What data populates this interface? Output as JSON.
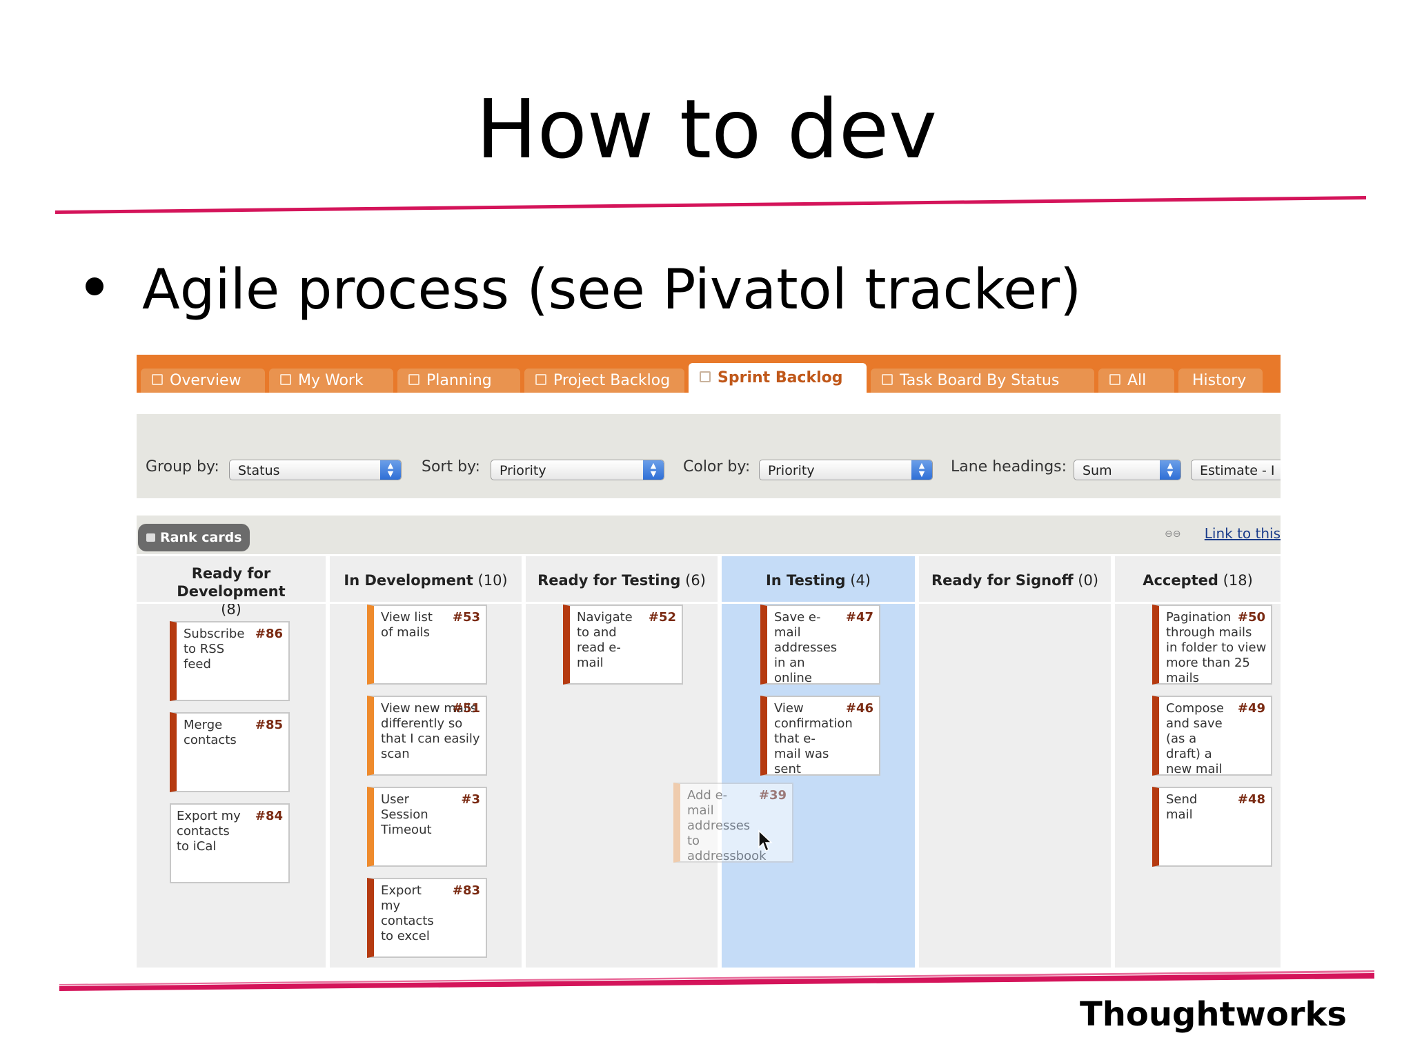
{
  "slide": {
    "title": "How to dev",
    "bullet": "Agile process (see Pivatol tracker)",
    "footer_brand": "Thoughtworks"
  },
  "colors": {
    "accent_rule": "#d4145a",
    "tab_bar": "#e8792a",
    "active_lane": "#c5dcf7",
    "card_red": "#b53a10",
    "card_orange": "#ee8a2c"
  },
  "app": {
    "tabs": [
      {
        "label": "Overview",
        "icon": "page-icon"
      },
      {
        "label": "My Work",
        "icon": "list-icon"
      },
      {
        "label": "Planning",
        "icon": "grid-icon"
      },
      {
        "label": "Project Backlog",
        "icon": "list-icon"
      },
      {
        "label": "Sprint Backlog",
        "icon": "grid-icon",
        "active": true
      },
      {
        "label": "Task Board By Status",
        "icon": "grid-icon"
      },
      {
        "label": "All",
        "icon": "list-icon"
      },
      {
        "label": "History"
      }
    ],
    "controls": {
      "group_label": "Group by:",
      "group_value": "Status",
      "sort_label": "Sort by:",
      "sort_value": "Priority",
      "color_label": "Color by:",
      "color_value": "Priority",
      "lane_label": "Lane headings:",
      "lane_value": "Sum",
      "estimate_value": "Estimate - I"
    },
    "rank_cards": "Rank cards",
    "link_this": "Link to this",
    "lanes": [
      {
        "name": "Ready for Development",
        "count": "(8)",
        "cards": [
          {
            "title": "Subscribe to RSS feed",
            "num": "#86",
            "color": "red"
          },
          {
            "title": "Merge contacts",
            "num": "#85",
            "color": "red"
          },
          {
            "title": "Export my contacts to iCal",
            "num": "#84",
            "color": "none"
          }
        ]
      },
      {
        "name": "In Development",
        "count": "(10)",
        "cards": [
          {
            "title": "View list of mails",
            "num": "#53",
            "color": "orange"
          },
          {
            "title": "View new mails differently so that I can easily scan",
            "num": "#51",
            "color": "orange"
          },
          {
            "title": "User Session Timeout",
            "num": "#3",
            "color": "orange"
          },
          {
            "title": "Export my contacts to excel",
            "num": "#83",
            "color": "red"
          }
        ]
      },
      {
        "name": "Ready for Testing",
        "count": "(6)",
        "cards": [
          {
            "title": "Navigate to and read e-mail",
            "num": "#52",
            "color": "red"
          }
        ]
      },
      {
        "name": "In Testing",
        "count": "(4)",
        "cards": [
          {
            "title": "Save e-mail addresses in an online address book",
            "num": "#47",
            "color": "red"
          },
          {
            "title": "View confirmation that e-mail was sent",
            "num": "#46",
            "color": "red"
          }
        ]
      },
      {
        "name": "Ready for Signoff",
        "count": "(0)",
        "cards": []
      },
      {
        "name": "Accepted",
        "count": "(18)",
        "cards": [
          {
            "title": "Pagination through mails in folder to view more than 25 mails",
            "num": "#50",
            "color": "red"
          },
          {
            "title": "Compose and save (as a draft) a new mail",
            "num": "#49",
            "color": "red"
          },
          {
            "title": "Send mail",
            "num": "#48",
            "color": "red"
          }
        ]
      }
    ],
    "dragging_card": {
      "title": "Add e-mail addresses to addressbook from received",
      "num": "#39"
    }
  }
}
